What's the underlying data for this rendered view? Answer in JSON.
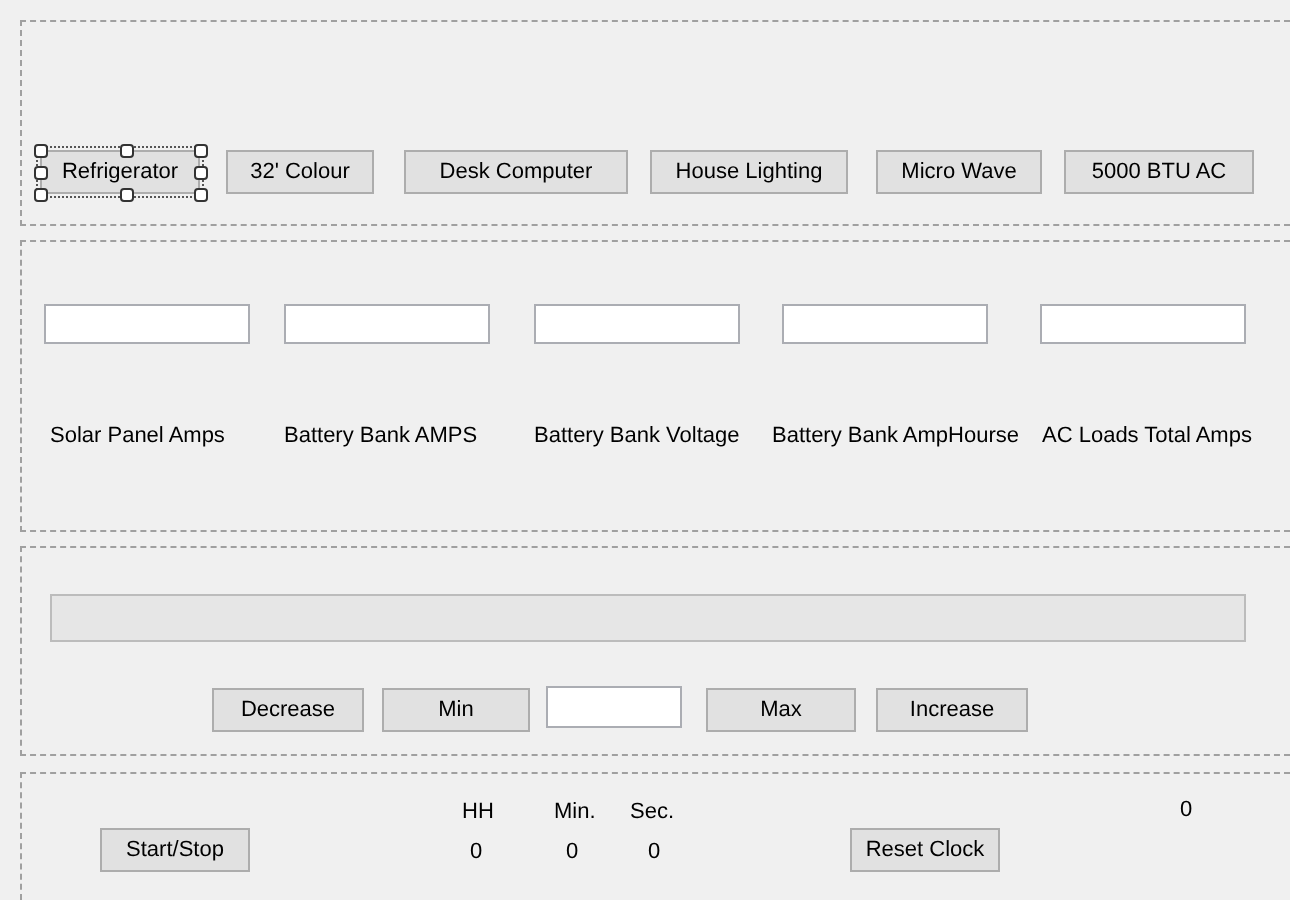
{
  "device_buttons": [
    {
      "label": "Refrigerator",
      "selected": true
    },
    {
      "label": "32' Colour",
      "selected": false
    },
    {
      "label": "Desk Computer",
      "selected": false
    },
    {
      "label": "House Lighting",
      "selected": false
    },
    {
      "label": "Micro Wave",
      "selected": false
    },
    {
      "label": "5000 BTU AC",
      "selected": false
    }
  ],
  "readings": [
    {
      "label": "Solar Panel Amps"
    },
    {
      "label": "Battery Bank AMPS"
    },
    {
      "label": "Battery Bank Voltage"
    },
    {
      "label": "Battery Bank AmpHourse"
    },
    {
      "label": "AC Loads Total Amps"
    }
  ],
  "load_control": {
    "level": 0,
    "buttons": [
      "Decrease",
      "Min",
      "Max",
      "Increase"
    ]
  },
  "clock": {
    "start_button": "Start/Stop",
    "headers": [
      "HH",
      "Min.",
      "Sec."
    ],
    "values": [
      "0",
      "0",
      "0"
    ],
    "reset_button": "Reset Clock",
    "counter": "0"
  }
}
